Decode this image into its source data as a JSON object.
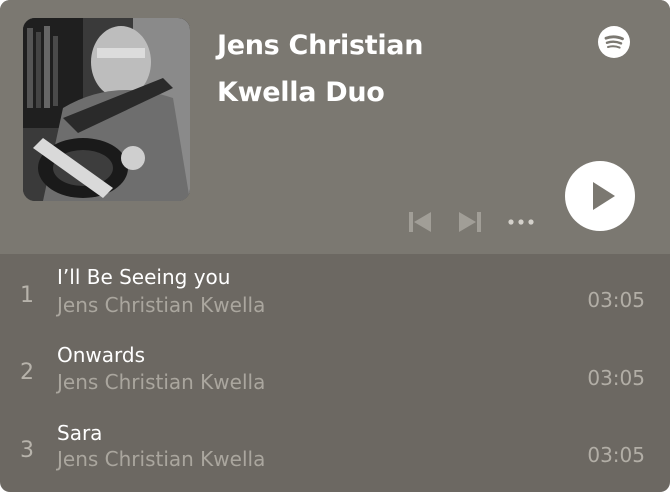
{
  "album": {
    "title_line1": "Jens Christian",
    "title_line2": "Kwella Duo",
    "cover": "album-cover-image"
  },
  "icons": {
    "spotify": "spotify-logo-icon",
    "previous": "skip-previous-icon",
    "next": "skip-next-icon",
    "more": "more-options-icon",
    "play": "play-icon"
  },
  "colors": {
    "header_bg": "#7b7871",
    "list_bg": "#6c6862",
    "text_primary": "#ffffff",
    "text_secondary": "#aaa69e",
    "play_button": "#ffffff"
  },
  "tracks": [
    {
      "number": "1",
      "title": "I’ll Be Seeing you",
      "artist": "Jens Christian Kwella",
      "duration": "03:05"
    },
    {
      "number": "2",
      "title": "Onwards",
      "artist": "Jens Christian Kwella",
      "duration": "03:05"
    },
    {
      "number": "3",
      "title": "Sara",
      "artist": "Jens Christian Kwella",
      "duration": "03:05"
    }
  ]
}
